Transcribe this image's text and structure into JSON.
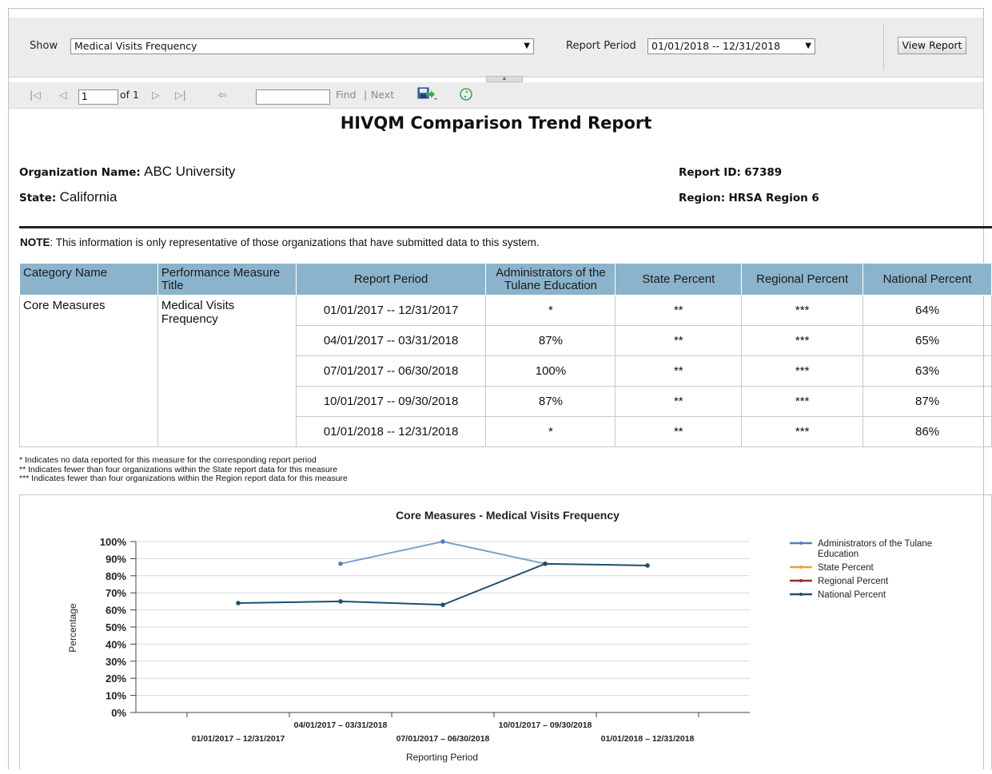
{
  "params": {
    "show_label": "Show",
    "show_value": "Medical Visits Frequency",
    "period_label": "Report Period",
    "period_value": "01/01/2018 -- 12/31/2018",
    "view_button": "View Report"
  },
  "toolbar": {
    "page_value": "1",
    "of_label": "of 1",
    "find_label": "Find",
    "sep": "|",
    "next_label": "Next"
  },
  "report": {
    "title": "HIVQM Comparison Trend Report",
    "org_label": "Organization Name:",
    "org_value": "ABC University",
    "state_label": "State:",
    "state_value": "California",
    "id_label": "Report ID:",
    "id_value": "67389",
    "region_label": "Region:",
    "region_value": "HRSA Region 6",
    "note_bold": "NOTE",
    "note_text": ": This information is only representative of those organizations that have submitted data to this system."
  },
  "table": {
    "headers": [
      "Category Name",
      "Performance Measure Title",
      "Report Period",
      "Administrators of the Tulane Education",
      "State Percent",
      "Regional Percent",
      "National Percent"
    ],
    "category": "Core Measures",
    "measure": "Medical Visits Frequency",
    "rows": [
      {
        "period": "01/01/2017 -- 12/31/2017",
        "admin": "*",
        "state": "**",
        "regional": "***",
        "national": "64%"
      },
      {
        "period": "04/01/2017 -- 03/31/2018",
        "admin": "87%",
        "state": "**",
        "regional": "***",
        "national": "65%"
      },
      {
        "period": "07/01/2017 -- 06/30/2018",
        "admin": "100%",
        "state": "**",
        "regional": "***",
        "national": "63%"
      },
      {
        "period": "10/01/2017 -- 09/30/2018",
        "admin": "87%",
        "state": "**",
        "regional": "***",
        "national": "87%"
      },
      {
        "period": "01/01/2018 -- 12/31/2018",
        "admin": "*",
        "state": "**",
        "regional": "***",
        "national": "86%"
      }
    ]
  },
  "footnotes": [
    "* Indicates no data reported for this measure for the corresponding report period",
    "** Indicates fewer than four organizations within the State report data for this measure",
    "*** Indicates fewer than four organizations within the Region report data for this measure"
  ],
  "chart_data": {
    "type": "line",
    "title": "Core Measures - Medical Visits Frequency",
    "xlabel": "Reporting Period",
    "ylabel": "Percentage",
    "ylim": [
      0,
      100
    ],
    "yticks": [
      "0%",
      "10%",
      "20%",
      "30%",
      "40%",
      "50%",
      "60%",
      "70%",
      "80%",
      "90%",
      "100%"
    ],
    "categories": [
      "01/01/2017 – 12/31/2017",
      "04/01/2017 – 03/31/2018",
      "07/01/2017 – 06/30/2018",
      "10/01/2017 – 09/30/2018",
      "01/01/2018 – 12/31/2018"
    ],
    "series": [
      {
        "name": "Administrators of the Tulane Education",
        "color": "#4f81bd",
        "values": [
          null,
          87,
          100,
          87,
          null
        ]
      },
      {
        "name": "State Percent",
        "color": "#f0a030",
        "values": [
          null,
          null,
          null,
          null,
          null
        ]
      },
      {
        "name": "Regional Percent",
        "color": "#9e2a2a",
        "values": [
          null,
          null,
          null,
          null,
          null
        ]
      },
      {
        "name": "National Percent",
        "color": "#1f4e6b",
        "values": [
          64,
          65,
          63,
          87,
          86
        ]
      }
    ],
    "grid": true,
    "legend": "right"
  }
}
